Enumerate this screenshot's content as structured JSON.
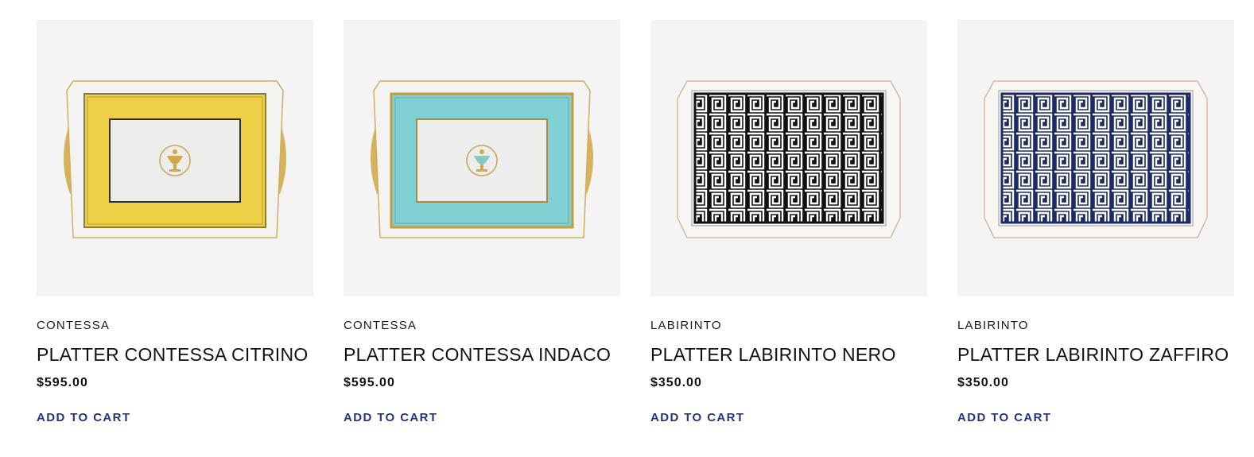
{
  "products": [
    {
      "collection": "CONTESSA",
      "name": "PLATTER CONTESSA CITRINO",
      "price": "$595.00",
      "cta": "ADD TO CART",
      "colors": {
        "field": "#efcf45",
        "accent": "#c9a24a"
      }
    },
    {
      "collection": "CONTESSA",
      "name": "PLATTER CONTESSA INDACO",
      "price": "$595.00",
      "cta": "ADD TO CART",
      "colors": {
        "field": "#7fd0d2",
        "accent": "#c9a24a"
      }
    },
    {
      "collection": "LABIRINTO",
      "name": "PLATTER LABIRINTO NERO",
      "price": "$350.00",
      "cta": "ADD TO CART",
      "colors": {
        "field": "#111111",
        "accent": "#d8b7a4"
      }
    },
    {
      "collection": "LABIRINTO",
      "name": "PLATTER LABIRINTO ZAFFIRO",
      "price": "$350.00",
      "cta": "ADD TO CART",
      "colors": {
        "field": "#1c2a66",
        "accent": "#d8b7a4"
      }
    }
  ]
}
